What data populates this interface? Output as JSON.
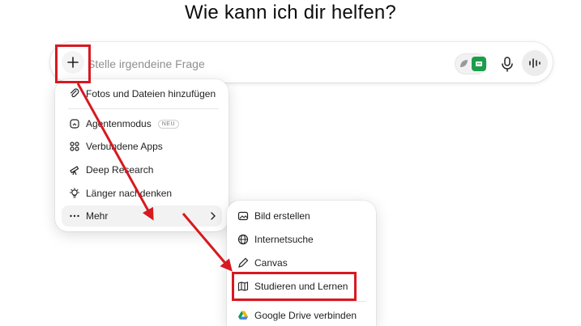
{
  "heading": "Wie kann ich dir helfen?",
  "composer": {
    "placeholder": "Stelle irgendeine Frage"
  },
  "menu": {
    "items": [
      {
        "label": "Fotos und Dateien hinzufügen",
        "icon": "paperclip-icon"
      },
      {
        "label": "Agentenmodus",
        "icon": "agent-icon",
        "badge": "NEU"
      },
      {
        "label": "Verbundene Apps",
        "icon": "apps-icon"
      },
      {
        "label": "Deep Research",
        "icon": "telescope-icon"
      },
      {
        "label": "Länger nachdenken",
        "icon": "lightbulb-icon"
      },
      {
        "label": "Mehr",
        "icon": "more-icon"
      }
    ]
  },
  "submenu": {
    "items": [
      {
        "label": "Bild erstellen",
        "icon": "image-icon"
      },
      {
        "label": "Internetsuche",
        "icon": "globe-icon"
      },
      {
        "label": "Canvas",
        "icon": "pencil-icon"
      },
      {
        "label": "Studieren und Lernen",
        "icon": "book-icon"
      },
      {
        "label": "Google Drive verbinden",
        "icon": "google-drive-icon"
      }
    ]
  },
  "colors": {
    "highlight": "#d71920",
    "ext_green": "#1b9e4b"
  }
}
